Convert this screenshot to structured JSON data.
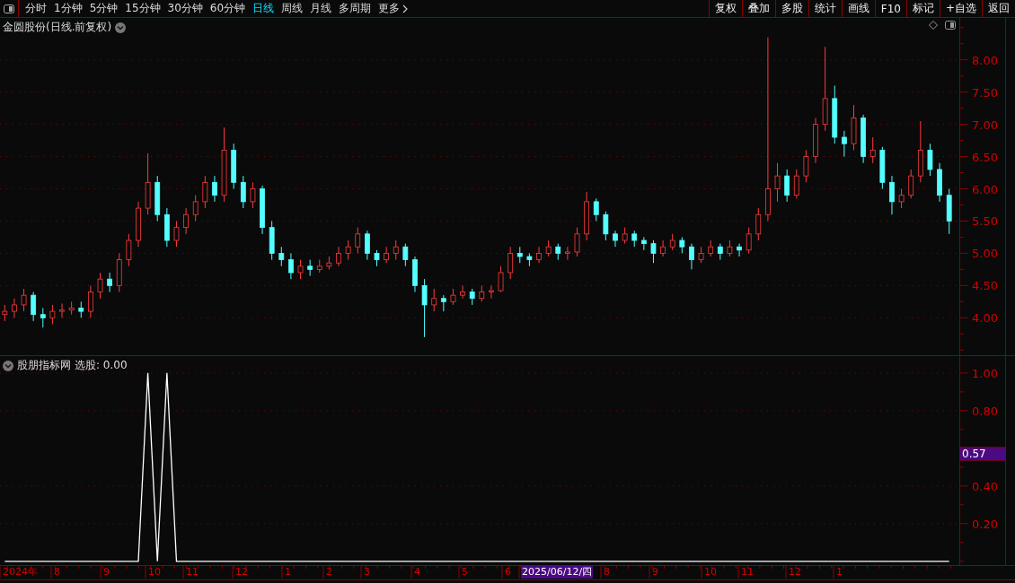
{
  "toolbar": {
    "periods": [
      {
        "label": "分时",
        "selected": false
      },
      {
        "label": "1分钟",
        "selected": false
      },
      {
        "label": "5分钟",
        "selected": false
      },
      {
        "label": "15分钟",
        "selected": false
      },
      {
        "label": "30分钟",
        "selected": false
      },
      {
        "label": "60分钟",
        "selected": false
      },
      {
        "label": "日线",
        "selected": true
      },
      {
        "label": "周线",
        "selected": false
      },
      {
        "label": "月线",
        "selected": false
      },
      {
        "label": "多周期",
        "selected": false
      },
      {
        "label": "更多",
        "selected": false
      }
    ],
    "actions": [
      "复权",
      "叠加",
      "多股",
      "统计",
      "画线",
      "F10",
      "标记",
      "+自选",
      "返回"
    ]
  },
  "price_chart": {
    "title": "金圆股份(日线.前复权)",
    "chart_data": {
      "type": "candlestick",
      "ylim": [
        3.42,
        8.65
      ],
      "grid": true,
      "yticks": [
        {
          "value": 8,
          "label": "8.00"
        },
        {
          "value": 7.5,
          "label": "7.50"
        },
        {
          "value": 7,
          "label": "7.00"
        },
        {
          "value": 6.5,
          "label": "6.50"
        },
        {
          "value": 6,
          "label": "6.00"
        },
        {
          "value": 5.5,
          "label": "5.50"
        },
        {
          "value": 5,
          "label": "5.00"
        },
        {
          "value": 4.5,
          "label": "4.50"
        },
        {
          "value": 4,
          "label": "4.00"
        }
      ],
      "ohlc": [
        [
          4.05,
          4.2,
          3.95,
          4.1
        ],
        [
          4.1,
          4.3,
          4.0,
          4.2
        ],
        [
          4.2,
          4.45,
          4.1,
          4.35
        ],
        [
          4.35,
          4.4,
          3.95,
          4.05
        ],
        [
          4.05,
          4.15,
          3.85,
          4.0
        ],
        [
          4.0,
          4.2,
          3.9,
          4.1
        ],
        [
          4.1,
          4.22,
          4.0,
          4.12
        ],
        [
          4.12,
          4.25,
          4.05,
          4.15
        ],
        [
          4.15,
          4.25,
          4.0,
          4.1
        ],
        [
          4.1,
          4.5,
          4.0,
          4.4
        ],
        [
          4.4,
          4.7,
          4.3,
          4.6
        ],
        [
          4.6,
          4.7,
          4.4,
          4.5
        ],
        [
          4.5,
          5.0,
          4.4,
          4.9
        ],
        [
          4.9,
          5.3,
          4.8,
          5.2
        ],
        [
          5.2,
          5.8,
          5.1,
          5.7
        ],
        [
          5.7,
          6.55,
          5.6,
          6.1
        ],
        [
          6.1,
          6.2,
          5.5,
          5.6
        ],
        [
          5.6,
          5.7,
          5.1,
          5.2
        ],
        [
          5.2,
          5.5,
          5.1,
          5.4
        ],
        [
          5.4,
          5.7,
          5.3,
          5.6
        ],
        [
          5.6,
          5.9,
          5.5,
          5.8
        ],
        [
          5.8,
          6.2,
          5.7,
          6.1
        ],
        [
          6.1,
          6.2,
          5.8,
          5.9
        ],
        [
          5.9,
          6.95,
          5.8,
          6.6
        ],
        [
          6.6,
          6.7,
          6.0,
          6.1
        ],
        [
          6.1,
          6.2,
          5.7,
          5.8
        ],
        [
          5.8,
          6.1,
          5.7,
          6.0
        ],
        [
          6.0,
          6.05,
          5.3,
          5.4
        ],
        [
          5.4,
          5.5,
          4.9,
          5.0
        ],
        [
          5.0,
          5.1,
          4.8,
          4.9
        ],
        [
          4.9,
          5.0,
          4.6,
          4.7
        ],
        [
          4.7,
          4.9,
          4.6,
          4.8
        ],
        [
          4.8,
          4.9,
          4.65,
          4.75
        ],
        [
          4.75,
          4.9,
          4.7,
          4.8
        ],
        [
          4.8,
          4.95,
          4.75,
          4.85
        ],
        [
          4.85,
          5.1,
          4.8,
          5.0
        ],
        [
          5.0,
          5.2,
          4.9,
          5.1
        ],
        [
          5.1,
          5.4,
          5.0,
          5.3
        ],
        [
          5.3,
          5.35,
          4.9,
          5.0
        ],
        [
          5.0,
          5.05,
          4.8,
          4.9
        ],
        [
          4.9,
          5.1,
          4.85,
          5.0
        ],
        [
          5.0,
          5.2,
          4.9,
          5.1
        ],
        [
          5.1,
          5.15,
          4.8,
          4.9
        ],
        [
          4.9,
          4.95,
          4.4,
          4.5
        ],
        [
          4.5,
          4.6,
          3.7,
          4.2
        ],
        [
          4.2,
          4.45,
          4.1,
          4.3
        ],
        [
          4.3,
          4.35,
          4.1,
          4.25
        ],
        [
          4.25,
          4.45,
          4.2,
          4.35
        ],
        [
          4.35,
          4.5,
          4.3,
          4.4
        ],
        [
          4.4,
          4.45,
          4.2,
          4.3
        ],
        [
          4.3,
          4.5,
          4.25,
          4.4
        ],
        [
          4.4,
          4.5,
          4.3,
          4.42
        ],
        [
          4.42,
          4.8,
          4.4,
          4.7
        ],
        [
          4.7,
          5.1,
          4.6,
          5.0
        ],
        [
          5.0,
          5.1,
          4.85,
          4.95
        ],
        [
          4.95,
          5.0,
          4.8,
          4.9
        ],
        [
          4.9,
          5.1,
          4.85,
          5.0
        ],
        [
          5.0,
          5.2,
          4.95,
          5.1
        ],
        [
          5.1,
          5.15,
          4.9,
          5.0
        ],
        [
          5.0,
          5.1,
          4.9,
          5.02
        ],
        [
          5.02,
          5.4,
          4.95,
          5.3
        ],
        [
          5.3,
          5.95,
          5.2,
          5.8
        ],
        [
          5.8,
          5.85,
          5.5,
          5.6
        ],
        [
          5.6,
          5.65,
          5.2,
          5.3
        ],
        [
          5.3,
          5.35,
          5.1,
          5.2
        ],
        [
          5.2,
          5.4,
          5.15,
          5.3
        ],
        [
          5.3,
          5.35,
          5.1,
          5.2
        ],
        [
          5.2,
          5.25,
          5.05,
          5.15
        ],
        [
          5.15,
          5.2,
          4.85,
          5.0
        ],
        [
          5.0,
          5.2,
          4.95,
          5.1
        ],
        [
          5.1,
          5.3,
          5.05,
          5.2
        ],
        [
          5.2,
          5.25,
          5.0,
          5.1
        ],
        [
          5.1,
          5.15,
          4.75,
          4.9
        ],
        [
          4.9,
          5.1,
          4.85,
          5.0
        ],
        [
          5.0,
          5.2,
          4.95,
          5.1
        ],
        [
          5.1,
          5.15,
          4.9,
          5.0
        ],
        [
          5.0,
          5.2,
          4.95,
          5.1
        ],
        [
          5.1,
          5.15,
          4.95,
          5.05
        ],
        [
          5.05,
          5.4,
          5.0,
          5.3
        ],
        [
          5.3,
          5.7,
          5.2,
          5.6
        ],
        [
          5.6,
          8.35,
          5.5,
          6.0
        ],
        [
          6.0,
          6.4,
          5.8,
          6.2
        ],
        [
          6.2,
          6.3,
          5.8,
          5.9
        ],
        [
          5.9,
          6.3,
          5.85,
          6.2
        ],
        [
          6.2,
          6.6,
          6.1,
          6.5
        ],
        [
          6.5,
          7.1,
          6.4,
          7.0
        ],
        [
          7.0,
          8.2,
          6.9,
          7.4
        ],
        [
          7.4,
          7.6,
          6.7,
          6.8
        ],
        [
          6.8,
          6.9,
          6.5,
          6.7
        ],
        [
          6.7,
          7.3,
          6.6,
          7.1
        ],
        [
          7.1,
          7.15,
          6.4,
          6.5
        ],
        [
          6.5,
          6.8,
          6.4,
          6.6
        ],
        [
          6.6,
          6.65,
          6.0,
          6.1
        ],
        [
          6.1,
          6.2,
          5.6,
          5.8
        ],
        [
          5.8,
          6.0,
          5.7,
          5.9
        ],
        [
          5.9,
          6.3,
          5.85,
          6.2
        ],
        [
          6.2,
          7.05,
          6.1,
          6.6
        ],
        [
          6.6,
          6.7,
          6.2,
          6.3
        ],
        [
          6.3,
          6.4,
          5.8,
          5.9
        ],
        [
          5.9,
          6.0,
          5.3,
          5.5
        ]
      ]
    }
  },
  "indicator": {
    "name": "股朋指标网",
    "reading": "选股: 0.00",
    "marker": "0.57",
    "chart_data": {
      "type": "line",
      "ylim": [
        -0.02,
        1.09
      ],
      "grid": true,
      "yticks": [
        {
          "value": 1,
          "label": "1.00"
        },
        {
          "value": 0.8,
          "label": "0.80"
        },
        {
          "value": 0.4,
          "label": "0.40"
        },
        {
          "value": 0.2,
          "label": "0.20"
        }
      ],
      "series": [
        {
          "color": "#ffffff",
          "values": [
            0,
            0,
            0,
            0,
            0,
            0,
            0,
            0,
            0,
            0,
            0,
            0,
            0,
            0,
            0,
            1,
            0,
            1,
            0,
            0,
            0,
            0,
            0,
            0,
            0,
            0,
            0,
            0,
            0,
            0,
            0,
            0,
            0,
            0,
            0,
            0,
            0,
            0,
            0,
            0,
            0,
            0,
            0,
            0,
            0,
            0,
            0,
            0,
            0,
            0,
            0,
            0,
            0,
            0,
            0,
            0,
            0,
            0,
            0,
            0,
            0,
            0,
            0,
            0,
            0,
            0,
            0,
            0,
            0,
            0,
            0,
            0,
            0,
            0,
            0,
            0,
            0,
            0,
            0,
            0,
            0,
            0,
            0,
            0,
            0,
            0,
            0,
            0,
            0,
            0,
            0,
            0,
            0,
            0,
            0,
            0,
            0,
            0,
            0,
            0
          ]
        }
      ]
    }
  },
  "date_axis": {
    "labels": [
      {
        "label": "2024年",
        "highlighted": false
      },
      {
        "label": "8",
        "highlighted": false
      },
      {
        "label": "9",
        "highlighted": false
      },
      {
        "label": "10",
        "highlighted": false
      },
      {
        "label": "11",
        "highlighted": false
      },
      {
        "label": "12",
        "highlighted": false
      },
      {
        "label": "1",
        "highlighted": false
      },
      {
        "label": "2",
        "highlighted": false
      },
      {
        "label": "3",
        "highlighted": false
      },
      {
        "label": "4",
        "highlighted": false
      },
      {
        "label": "5",
        "highlighted": false
      },
      {
        "label": "6",
        "highlighted": false
      },
      {
        "label": "2025/06/12/四",
        "highlighted": true
      },
      {
        "label": "8",
        "highlighted": false
      },
      {
        "label": "9",
        "highlighted": false
      },
      {
        "label": "10",
        "highlighted": false
      },
      {
        "label": "11",
        "highlighted": false
      },
      {
        "label": "12",
        "highlighted": false
      },
      {
        "label": "1",
        "highlighted": false
      }
    ]
  }
}
